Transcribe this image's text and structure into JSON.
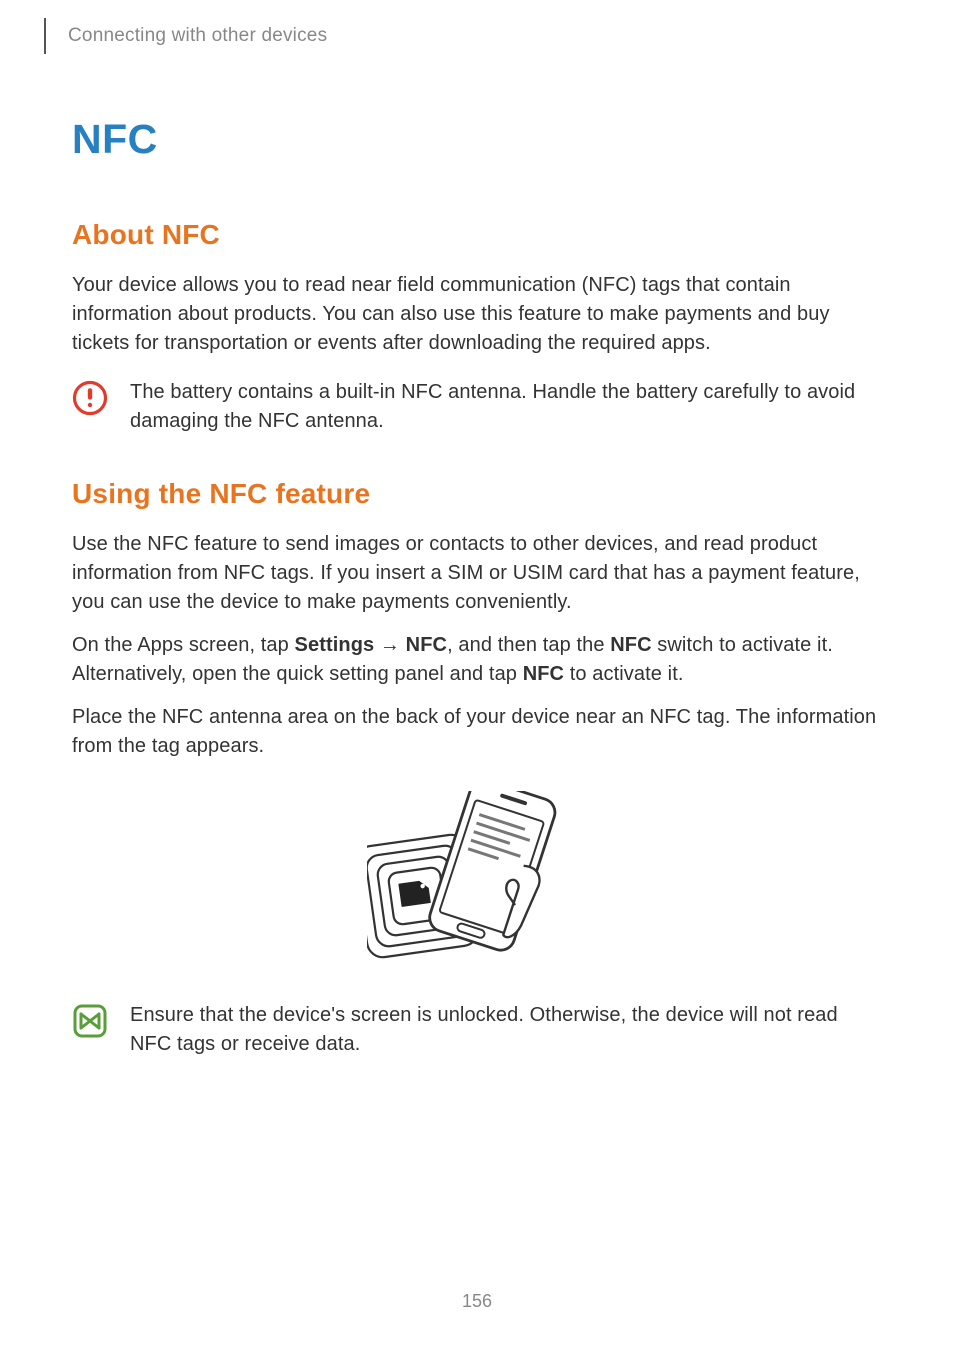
{
  "header": {
    "breadcrumb": "Connecting with other devices"
  },
  "h1": "NFC",
  "h2_about": "About NFC",
  "para_about": "Your device allows you to read near field communication (NFC) tags that contain information about products. You can also use this feature to make payments and buy tickets for transportation or events after downloading the required apps.",
  "callout_warning": "The battery contains a built-in NFC antenna. Handle the battery carefully to avoid damaging the NFC antenna.",
  "h2_using": "Using the NFC feature",
  "para_using1": "Use the NFC feature to send images or contacts to other devices, and read product information from NFC tags. If you insert a SIM or USIM card that has a payment feature, you can use the device to make payments conveniently.",
  "settings_line": {
    "pre": "On the Apps screen, tap ",
    "b1": "Settings",
    "arrow": " → ",
    "b2": "NFC",
    "mid": ", and then tap the ",
    "b3": "NFC",
    "post1": " switch to activate it. Alternatively, open the quick setting panel and tap ",
    "b4": "NFC",
    "post2": " to activate it."
  },
  "para_using3": "Place the NFC antenna area on the back of your device near an NFC tag. The information from the tag appears.",
  "callout_note": "Ensure that the device's screen is unlocked. Otherwise, the device will not read NFC tags or receive data.",
  "page_number": "156"
}
